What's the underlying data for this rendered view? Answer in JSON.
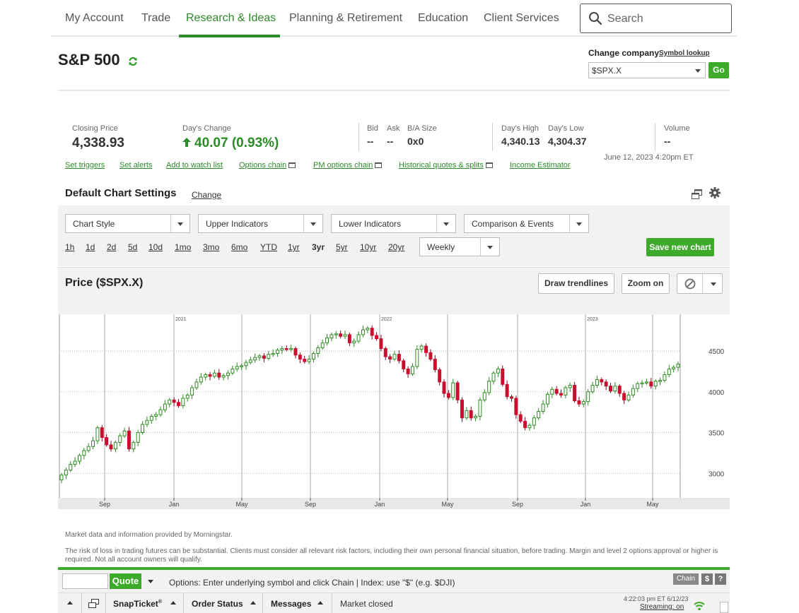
{
  "nav": {
    "items": [
      "My Account",
      "Trade",
      "Research & Ideas",
      "Planning & Retirement",
      "Education",
      "Client Services"
    ],
    "active": "Research & Ideas",
    "search_label": "Search"
  },
  "header": {
    "title": "S&P 500",
    "change_company_label": "Change company",
    "symbol_lookup": "Symbol lookup",
    "symbol_value": "$SPX.X",
    "go_label": "Go"
  },
  "stats": {
    "closing_label": "Closing Price",
    "closing_value": "4,338.93",
    "change_label": "Day's Change",
    "change_value": "40.07 (0.93%)",
    "bid_label": "Bid",
    "bid_value": "--",
    "ask_label": "Ask",
    "ask_value": "--",
    "ba_size_label": "B/A Size",
    "ba_size_value": "0x0",
    "high_label": "Day's High",
    "high_value": "4,340.13",
    "low_label": "Day's Low",
    "low_value": "4,304.37",
    "volume_label": "Volume",
    "volume_value": "--",
    "timestamp": "June 12, 2023 4:20pm ET"
  },
  "links": {
    "set_triggers": "Set triggers",
    "set_alerts": "Set alerts",
    "watch_list": "Add to watch list",
    "options_chain": "Options chain",
    "pm_options_chain": "PM options chain",
    "historical": "Historical quotes & splits",
    "income_estimator": "Income Estimator"
  },
  "settings": {
    "title": "Default Chart Settings",
    "change_label": "Change",
    "chart_style": "Chart Style",
    "upper_indicators": "Upper Indicators",
    "lower_indicators": "Lower Indicators",
    "comparison": "Comparison & Events",
    "ranges": [
      "1h",
      "1d",
      "2d",
      "5d",
      "10d",
      "1mo",
      "3mo",
      "6mo",
      "YTD",
      "1yr",
      "3yr",
      "5yr",
      "10yr",
      "20yr"
    ],
    "selected_range": "3yr",
    "frequency": "Weekly",
    "save_label": "Save new chart"
  },
  "price_panel": {
    "title": "Price ($SPX.X)",
    "draw_trendlines": "Draw trendlines",
    "zoom_on": "Zoom on"
  },
  "chart_data": {
    "type": "candlestick",
    "frequency": "Weekly",
    "y_ticks": [
      3000,
      3500,
      4000,
      4500
    ],
    "ylim": [
      2700,
      4950
    ],
    "x_month_labels": [
      "Sep",
      "Jan",
      "May",
      "Sep",
      "Jan",
      "May",
      "Sep",
      "Jan",
      "May"
    ],
    "year_labels": [
      "2021",
      "2022",
      "2023"
    ],
    "grid": true,
    "closes": [
      2980,
      3040,
      3110,
      3150,
      3220,
      3280,
      3330,
      3400,
      3560,
      3440,
      3350,
      3300,
      3380,
      3460,
      3520,
      3300,
      3380,
      3500,
      3600,
      3650,
      3700,
      3720,
      3780,
      3850,
      3900,
      3870,
      3830,
      3920,
      3960,
      4050,
      4120,
      4180,
      4210,
      4190,
      4230,
      4180,
      4200,
      4230,
      4280,
      4310,
      4320,
      4360,
      4390,
      4420,
      4440,
      4410,
      4460,
      4470,
      4510,
      4530,
      4520,
      4530,
      4450,
      4400,
      4370,
      4400,
      4470,
      4540,
      4600,
      4660,
      4700,
      4710,
      4680,
      4700,
      4600,
      4620,
      4700,
      4760,
      4780,
      4690,
      4650,
      4530,
      4430,
      4400,
      4460,
      4380,
      4280,
      4220,
      4310,
      4520,
      4560,
      4480,
      4400,
      4270,
      4120,
      3980,
      3930,
      4110,
      3900,
      3680,
      3770,
      3680,
      3700,
      3900,
      3990,
      4130,
      4230,
      4280,
      4090,
      3940,
      3920,
      3720,
      3640,
      3560,
      3590,
      3680,
      3760,
      3850,
      3970,
      4030,
      3980,
      3960,
      4050,
      4080,
      3890,
      3850,
      3880,
      4000,
      4080,
      4150,
      4120,
      4070,
      4010,
      4070,
      3980,
      3900,
      3960,
      4040,
      4100,
      4110,
      4120,
      4070,
      4130,
      4140,
      4210,
      4280,
      4300,
      4339
    ]
  },
  "footer": {
    "morningstar": "Market data and information provided by Morningstar.",
    "risk": "The risk of loss in trading futures can be substantial. Clients must consider all relevant risk factors, including their own personal financial situation, before trading. Margin and level 2 options approval or higher is required. Not all account owners will qualify.",
    "quote_label": "Quote",
    "options_hint": "Options: Enter underlying symbol and click Chain | Index: use \"$\" (e.g. $DJI)",
    "chain_label": "Chain",
    "dollar_label": "$",
    "help_label": "?",
    "snapticket": "SnapTicket",
    "snapticket_sup": "®",
    "order_status": "Order Status",
    "messages": "Messages",
    "market_status": "Market closed",
    "stream_time": "4:22:03 pm ET 6/12/23",
    "streaming": "Streaming: on"
  },
  "colors": {
    "brand_green": "#2c8b28",
    "button_green": "#3daa2b",
    "candle_up": "#2e8b22",
    "candle_down": "#c8102e"
  }
}
